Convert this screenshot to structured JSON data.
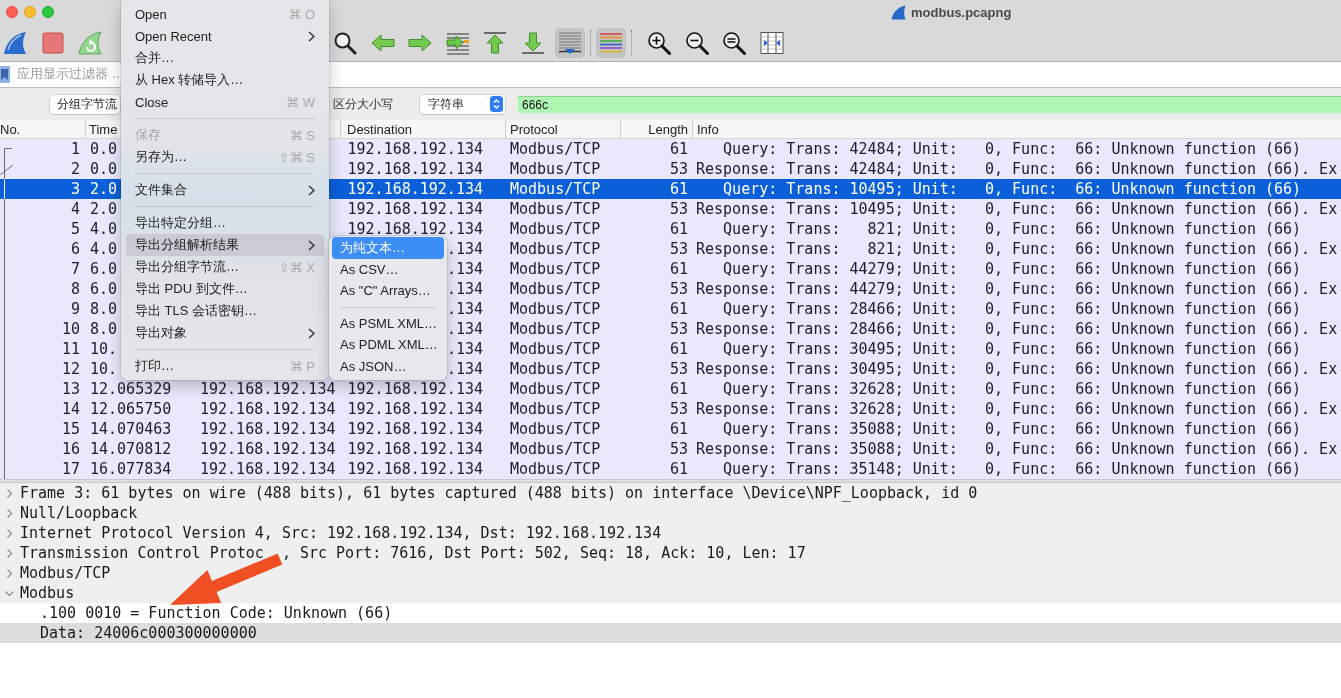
{
  "window": {
    "title": "modbus.pcapng"
  },
  "toolbar": {
    "groups": [
      [
        {
          "kind": "start",
          "on": false
        },
        {
          "kind": "stop",
          "on": false
        },
        {
          "kind": "restart",
          "on": false
        }
      ],
      [
        {
          "kind": "find",
          "on": false
        },
        {
          "kind": "back",
          "on": false
        },
        {
          "kind": "forward",
          "on": false
        },
        {
          "kind": "go-to",
          "on": false
        },
        {
          "kind": "first",
          "on": false
        },
        {
          "kind": "last",
          "on": false
        },
        {
          "kind": "autoscroll",
          "on": true
        }
      ],
      [
        {
          "kind": "colorize",
          "on": true
        }
      ],
      [
        {
          "kind": "zoom-in",
          "on": false
        },
        {
          "kind": "zoom-out",
          "on": false
        },
        {
          "kind": "zoom-reset",
          "on": false
        },
        {
          "kind": "resize-columns",
          "on": false
        }
      ]
    ]
  },
  "display_filter": {
    "placeholder": "应用显示过滤器 …"
  },
  "find_bar": {
    "search_in": "分组字节流",
    "case_label": "区分大小写",
    "search_type": "字符串",
    "value": "666c"
  },
  "packet_list": {
    "header": {
      "no": "No.",
      "time": "Time",
      "destination": "Destination",
      "protocol": "Protocol",
      "length": "Length",
      "info": "Info"
    },
    "rows": [
      {
        "kind": "start",
        "no": "1",
        "time": "0.0",
        "destination": "192.168.192.134",
        "protocol": "Modbus/TCP",
        "length": "61",
        "info": "   Query: Trans: 42484; Unit:   0, Func:  66: Unknown function (66)",
        "selected": false
      },
      {
        "kind": "response",
        "no": "2",
        "time": "0.0",
        "destination": "192.168.192.134",
        "protocol": "Modbus/TCP",
        "length": "53",
        "info": "Response: Trans: 42484; Unit:   0, Func:  66: Unknown function (66). Ex",
        "selected": false
      },
      {
        "kind": "line",
        "no": "3",
        "time": "2.0",
        "destination": "192.168.192.134",
        "protocol": "Modbus/TCP",
        "length": "61",
        "info": "   Query: Trans: 10495; Unit:   0, Func:  66: Unknown function (66)",
        "selected": true
      },
      {
        "kind": "line",
        "no": "4",
        "time": "2.0",
        "destination": "192.168.192.134",
        "protocol": "Modbus/TCP",
        "length": "53",
        "info": "Response: Trans: 10495; Unit:   0, Func:  66: Unknown function (66). Ex",
        "selected": false
      },
      {
        "kind": "line",
        "no": "5",
        "time": "4.0",
        "destination": "192.168.192.134",
        "protocol": "Modbus/TCP",
        "length": "61",
        "info": "   Query: Trans:   821; Unit:   0, Func:  66: Unknown function (66)",
        "selected": false
      },
      {
        "kind": "line",
        "no": "6",
        "time": "4.0",
        "destination": ".134",
        "protocol": "Modbus/TCP",
        "length": "53",
        "info": "Response: Trans:   821; Unit:   0, Func:  66: Unknown function (66). Ex",
        "selected": false
      },
      {
        "kind": "line",
        "no": "7",
        "time": "6.0",
        "destination": ".134",
        "protocol": "Modbus/TCP",
        "length": "61",
        "info": "   Query: Trans: 44279; Unit:   0, Func:  66: Unknown function (66)",
        "selected": false
      },
      {
        "kind": "line",
        "no": "8",
        "time": "6.0",
        "destination": ".134",
        "protocol": "Modbus/TCP",
        "length": "53",
        "info": "Response: Trans: 44279; Unit:   0, Func:  66: Unknown function (66). Ex",
        "selected": false
      },
      {
        "kind": "line",
        "no": "9",
        "time": "8.0",
        "destination": ".134",
        "protocol": "Modbus/TCP",
        "length": "61",
        "info": "   Query: Trans: 28466; Unit:   0, Func:  66: Unknown function (66)",
        "selected": false
      },
      {
        "kind": "line",
        "no": "10",
        "time": "8.0",
        "destination": ".134",
        "protocol": "Modbus/TCP",
        "length": "53",
        "info": "Response: Trans: 28466; Unit:   0, Func:  66: Unknown function (66). Ex",
        "selected": false
      },
      {
        "kind": "line",
        "no": "11",
        "time": "10.",
        "destination": ".134",
        "protocol": "Modbus/TCP",
        "length": "61",
        "info": "   Query: Trans: 30495; Unit:   0, Func:  66: Unknown function (66)",
        "selected": false
      },
      {
        "kind": "line",
        "no": "12",
        "time": "10.",
        "destination": ".134",
        "protocol": "Modbus/TCP",
        "length": "53",
        "info": "Response: Trans: 30495; Unit:   0, Func:  66: Unknown function (66). Ex",
        "selected": false
      },
      {
        "kind": "line",
        "no": "13",
        "time": "12.065329",
        "column_3": "192.168.192.134",
        "destination": "192.168.192.134",
        "protocol": "Modbus/TCP",
        "length": "61",
        "info": "   Query: Trans: 32628; Unit:   0, Func:  66: Unknown function (66)",
        "selected": false
      },
      {
        "kind": "line",
        "no": "14",
        "time": "12.065750",
        "column_3": "192.168.192.134",
        "destination": "192.168.192.134",
        "protocol": "Modbus/TCP",
        "length": "53",
        "info": "Response: Trans: 32628; Unit:   0, Func:  66: Unknown function (66). Ex",
        "selected": false
      },
      {
        "kind": "line",
        "no": "15",
        "time": "14.070463",
        "column_3": "192.168.192.134",
        "destination": "192.168.192.134",
        "protocol": "Modbus/TCP",
        "length": "61",
        "info": "   Query: Trans: 35088; Unit:   0, Func:  66: Unknown function (66)",
        "selected": false
      },
      {
        "kind": "line",
        "no": "16",
        "time": "14.070812",
        "column_3": "192.168.192.134",
        "destination": "192.168.192.134",
        "protocol": "Modbus/TCP",
        "length": "53",
        "info": "Response: Trans: 35088; Unit:   0, Func:  66: Unknown function (66). Ex",
        "selected": false
      },
      {
        "kind": "line",
        "no": "17",
        "time": "16.077834",
        "column_3": "192.168.192.134",
        "destination": "192.168.192.134",
        "protocol": "Modbus/TCP",
        "length": "61",
        "info": "   Query: Trans: 35148; Unit:   0, Func:  66: Unknown function (66)",
        "selected": false
      }
    ]
  },
  "packet_details": {
    "items": [
      {
        "text": "Frame 3: 61 bytes on wire (488 bits), 61 bytes captured (488 bits) on interface \\Device\\NPF_Loopback, id 0",
        "expanded": false,
        "selected": false
      },
      {
        "text": "Null/Loopback",
        "expanded": false,
        "selected": false
      },
      {
        "text": "Internet Protocol Version 4, Src: 192.168.192.134, Dst: 192.168.192.134",
        "expanded": false,
        "selected": false
      },
      {
        "text_parts": [
          "Transmission Control Protoc",
          ", Src Port: 7616, Dst Port: 502, Seq: 18, Ack: 10, Len: 17"
        ],
        "expanded": false,
        "selected": false
      },
      {
        "text": "Modbus/TCP",
        "expanded": false,
        "selected": false
      },
      {
        "text": "Modbus",
        "expanded": true,
        "selected": false,
        "children": [
          {
            "text": ".100 0010 = Function Code: Unknown (66)",
            "selected": false
          },
          {
            "text": "Data: 24006c000300000000",
            "selected": true
          }
        ]
      }
    ]
  },
  "file_menu": {
    "items": [
      {
        "kind": "item",
        "label": "Open",
        "shortcut": "⌘ O",
        "disabled": false,
        "selected": false
      },
      {
        "kind": "submenu",
        "label": "Open Recent",
        "disabled": false,
        "selected": false
      },
      {
        "kind": "item",
        "label": "合并…",
        "disabled": false,
        "selected": false
      },
      {
        "kind": "item",
        "label": "从 Hex 转储导入…",
        "disabled": false,
        "selected": false
      },
      {
        "kind": "item",
        "label": "Close",
        "shortcut": "⌘ W",
        "disabled": false,
        "selected": false
      },
      {
        "kind": "separator"
      },
      {
        "kind": "item",
        "label": "保存",
        "shortcut": "⌘ S",
        "disabled": true,
        "selected": false
      },
      {
        "kind": "item",
        "label": "另存为…",
        "shortcut": "⇧⌘ S",
        "disabled": false,
        "selected": false
      },
      {
        "kind": "separator"
      },
      {
        "kind": "submenu",
        "label": "文件集合",
        "disabled": false,
        "selected": false
      },
      {
        "kind": "separator"
      },
      {
        "kind": "item",
        "label": "导出特定分组…",
        "disabled": false,
        "selected": false
      },
      {
        "kind": "submenu",
        "label": "导出分组解析结果",
        "disabled": false,
        "selected": true
      },
      {
        "kind": "item",
        "label": "导出分组字节流…",
        "shortcut": "⇧⌘ X",
        "disabled": false,
        "selected": false
      },
      {
        "kind": "item",
        "label": "导出 PDU 到文件…",
        "disabled": false,
        "selected": false
      },
      {
        "kind": "item",
        "label": "导出 TLS 会话密钥…",
        "disabled": false,
        "selected": false
      },
      {
        "kind": "submenu",
        "label": "导出对象",
        "disabled": false,
        "selected": false
      },
      {
        "kind": "separator"
      },
      {
        "kind": "item",
        "label": "打印…",
        "shortcut": "⌘ P",
        "disabled": false,
        "selected": false
      }
    ]
  },
  "export_submenu": {
    "items": [
      {
        "kind": "item",
        "label": "为纯文本…",
        "selected": true
      },
      {
        "kind": "item",
        "label": "As CSV…",
        "selected": false
      },
      {
        "kind": "item",
        "label": "As \"C\" Arrays…",
        "selected": false
      },
      {
        "kind": "separator"
      },
      {
        "kind": "item",
        "label": "As PSML XML…",
        "selected": false
      },
      {
        "kind": "item",
        "label": "As PDML XML…",
        "selected": false
      },
      {
        "kind": "item",
        "label": "As JSON…",
        "selected": false
      }
    ]
  }
}
